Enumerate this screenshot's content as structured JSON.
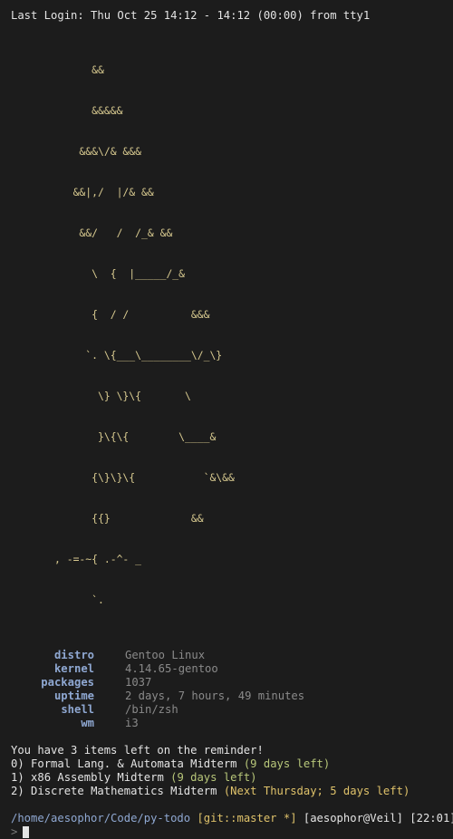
{
  "login_line": "Last Login: Thu Oct 25 14:12 - 14:12 (00:00) from tty1",
  "ascii_art": [
    "      &&",
    "      &&&&&",
    "    &&&\\/& &&&",
    "   &&|,/  |/& &&",
    "    &&/   /  /_& &&",
    "      \\  {  |_____/_&",
    "      {  / /          &&&",
    "     `. \\{___\\________\\/_\\}",
    "       \\} \\}\\{       \\",
    "       }\\{\\{        \\____&",
    "      {\\}\\}\\{           `&\\&&",
    "      {{}             &&",
    ", -=-~{ .-^- _",
    "      `."
  ],
  "sysinfo": [
    {
      "key": "distro",
      "value": "Gentoo Linux"
    },
    {
      "key": "kernel",
      "value": "4.14.65-gentoo"
    },
    {
      "key": "packages",
      "value": "1037"
    },
    {
      "key": "uptime",
      "value": "2 days, 7 hours, 49 minutes"
    },
    {
      "key": "shell",
      "value": "/bin/zsh"
    },
    {
      "key": "wm",
      "value": "i3"
    }
  ],
  "reminder": {
    "header": "You have 3 items left on the reminder!",
    "items": [
      {
        "index": "0)",
        "task": "Formal Lang. & Automata Midterm",
        "due": "(9 days left)",
        "due_color": "green"
      },
      {
        "index": "1)",
        "task": "x86 Assembly Midterm",
        "due": "(9 days left)",
        "due_color": "green"
      },
      {
        "index": "2)",
        "task": "Discrete Mathematics Midterm",
        "due": "(Next Thursday; 5 days left)",
        "due_color": "yellow"
      }
    ]
  },
  "prompt": {
    "path": "/home/aesophor/Code/py-todo",
    "git": "[git::master *]",
    "user": "[aesophor@Veil]",
    "time": "[22:01]",
    "symbol": ">"
  },
  "colors": {
    "background": "#1c1c1c",
    "foreground": "#e4e4e4",
    "art": "#d7c98f",
    "key": "#8fa8d2",
    "value": "#8a8a8a",
    "green": "#b8c77a",
    "yellow": "#dfc26a"
  }
}
